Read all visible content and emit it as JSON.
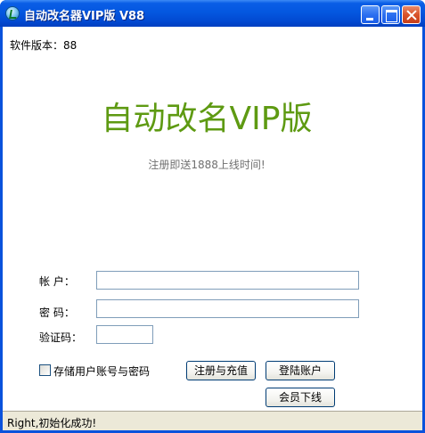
{
  "window": {
    "title": "自动改名器VIP版  V88"
  },
  "version": {
    "label": "软件版本：88"
  },
  "main": {
    "big_title": "自动改名VIP版",
    "promo": "注册即送1888上线时间!"
  },
  "form": {
    "account_label": "帐  户：",
    "account_value": "",
    "password_label": "密  码：",
    "password_value": "",
    "captcha_label": "验证码：",
    "captcha_value": "",
    "remember_label": "存储用户账号与密码",
    "remember_checked": false
  },
  "buttons": {
    "register": "注册与充值",
    "login": "登陆账户",
    "logout": "会员下线"
  },
  "status": {
    "text": "Right,初始化成功!"
  },
  "colors": {
    "title_green": "#5e9a12",
    "titlebar_blue": "#0457e0"
  }
}
